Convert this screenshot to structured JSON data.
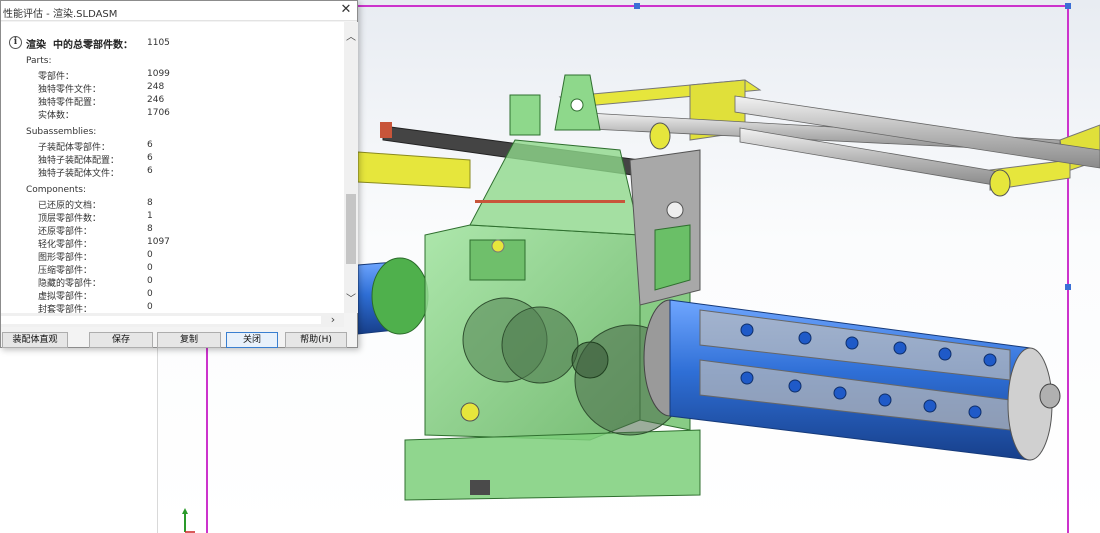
{
  "window": {
    "title": "性能评估 - 渲染.SLDASM",
    "close_glyph": "✕"
  },
  "summary": {
    "label": "渲染  中的总零部件数：",
    "value": "1105"
  },
  "sections": {
    "parts": {
      "heading": "Parts:",
      "rows": [
        {
          "label": "零部件：",
          "value": "1099"
        },
        {
          "label": "独特零件文件：",
          "value": "248"
        },
        {
          "label": "独特零件配置：",
          "value": "246"
        },
        {
          "label": "实体数：",
          "value": "1706"
        }
      ]
    },
    "subassemblies": {
      "heading": "Subassemblies:",
      "rows": [
        {
          "label": "子装配体零部件：",
          "value": "6"
        },
        {
          "label": "独特子装配体配置：",
          "value": "6"
        },
        {
          "label": "独特子装配体文件：",
          "value": "6"
        }
      ]
    },
    "components": {
      "heading": "Components:",
      "rows": [
        {
          "label": "已还原的文档：",
          "value": "8"
        },
        {
          "label": "顶层零部件数：",
          "value": "1"
        },
        {
          "label": "还原零部件：",
          "value": "8"
        },
        {
          "label": "轻化零部件：",
          "value": "1097"
        },
        {
          "label": "图形零部件：",
          "value": "0"
        },
        {
          "label": "压缩零部件：",
          "value": "0"
        },
        {
          "label": "隐藏的零部件：",
          "value": "0"
        },
        {
          "label": "虚拟零部件：",
          "value": "0"
        },
        {
          "label": "封套零部件：",
          "value": "0"
        }
      ]
    }
  },
  "buttons": {
    "assembly_visualization": "装配体直观",
    "save": "保存",
    "copy": "复制",
    "close": "关闭",
    "help": "帮助(H)"
  },
  "colors": {
    "selection_box": "#cc33cc",
    "housing_green": "#7ccf7a",
    "roller_blue": "#2f6fd6",
    "frame_yellow": "#e6e63c"
  },
  "icons": {
    "info": "info-icon",
    "close": "close-icon",
    "scroll_up": "chevron-up-icon",
    "scroll_down": "chevron-down-icon",
    "scroll_right": "chevron-right-icon"
  }
}
